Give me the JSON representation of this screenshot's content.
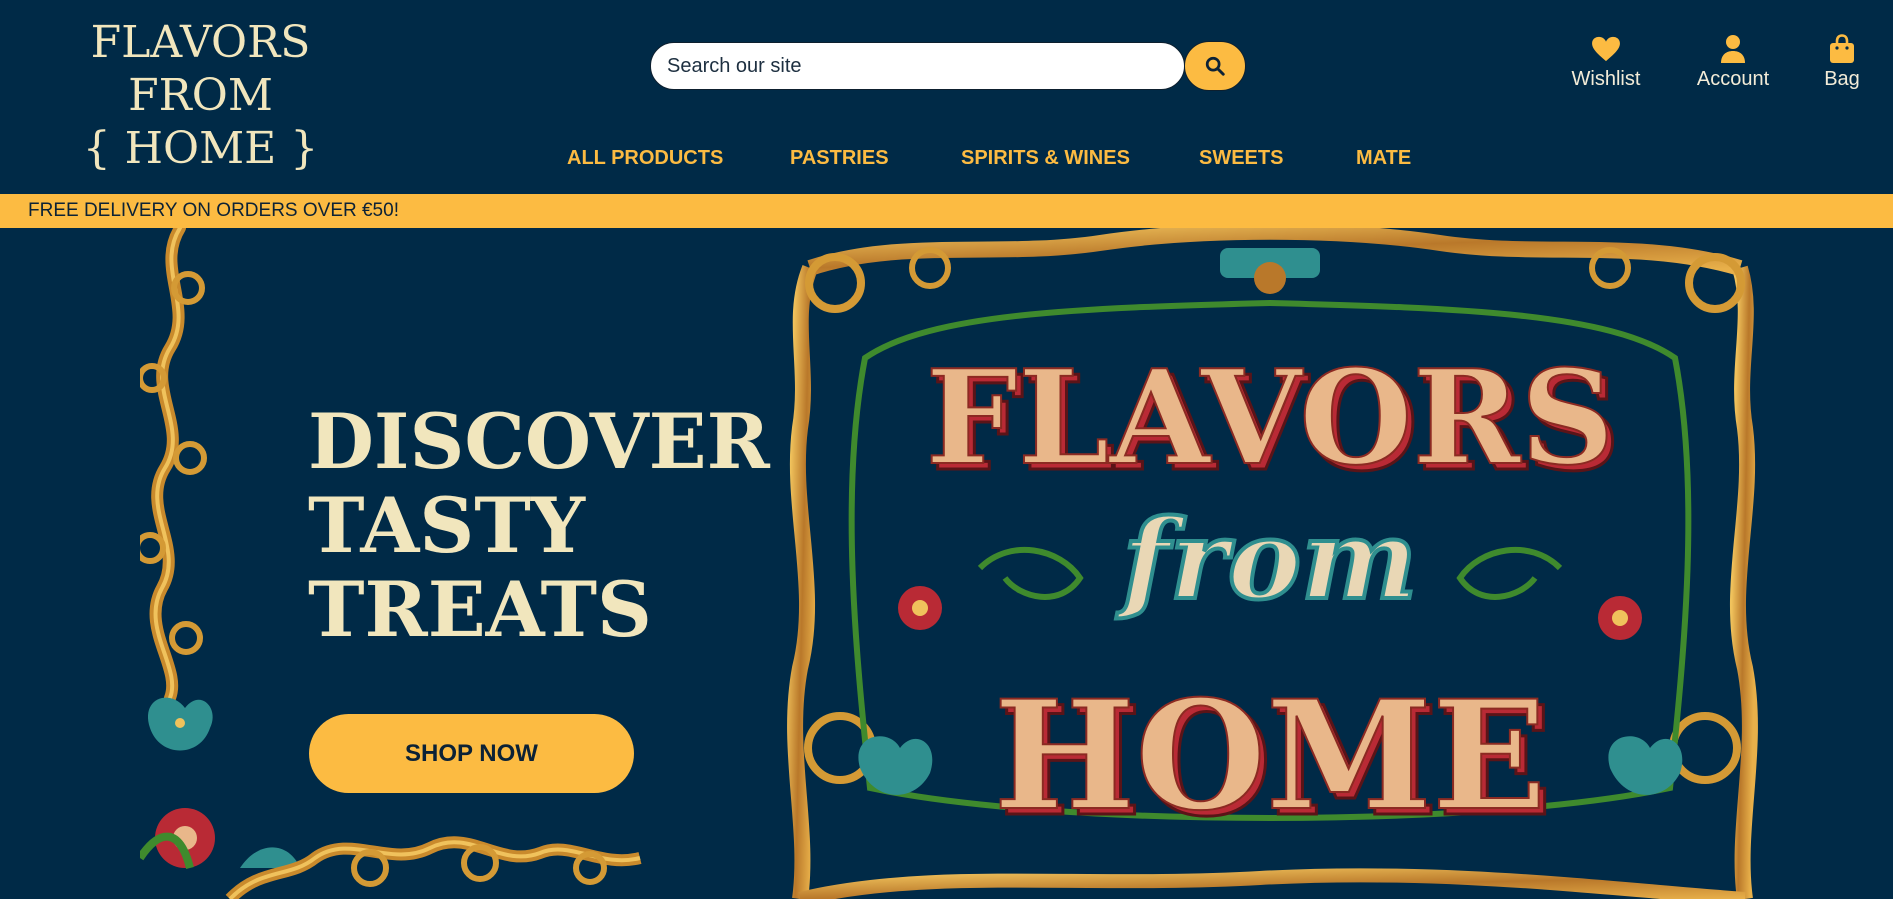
{
  "brand": {
    "logo_line1": "FLAVORS FROM",
    "logo_line2": "{ HOME }"
  },
  "search": {
    "placeholder": "Search our site",
    "button_icon": "search-icon"
  },
  "utility": {
    "wishlist": {
      "label": "Wishlist",
      "icon": "heart-icon"
    },
    "account": {
      "label": "Account",
      "icon": "user-icon"
    },
    "bag": {
      "label": "Bag",
      "icon": "shopping-bag-icon"
    }
  },
  "nav": {
    "items": [
      {
        "label": "ALL PRODUCTS"
      },
      {
        "label": "PASTRIES"
      },
      {
        "label": "SPIRITS & WINES"
      },
      {
        "label": "SWEETS"
      },
      {
        "label": "MATE"
      }
    ]
  },
  "promo": {
    "text": "FREE DELIVERY ON ORDERS OVER €50!"
  },
  "hero": {
    "title_lines": [
      "DISCOVER",
      "TASTY",
      "TREATS"
    ],
    "cta_label": "SHOP NOW",
    "sign": {
      "line1": "FLAVORS",
      "line2": "from",
      "line3": "HOME"
    }
  },
  "colors": {
    "navy": "#002a47",
    "gold": "#fcbb42",
    "cream": "#f1e6bd",
    "sign_red": "#b92a35",
    "sign_tan": "#e9b78a",
    "sign_teal": "#2f8f8f"
  }
}
